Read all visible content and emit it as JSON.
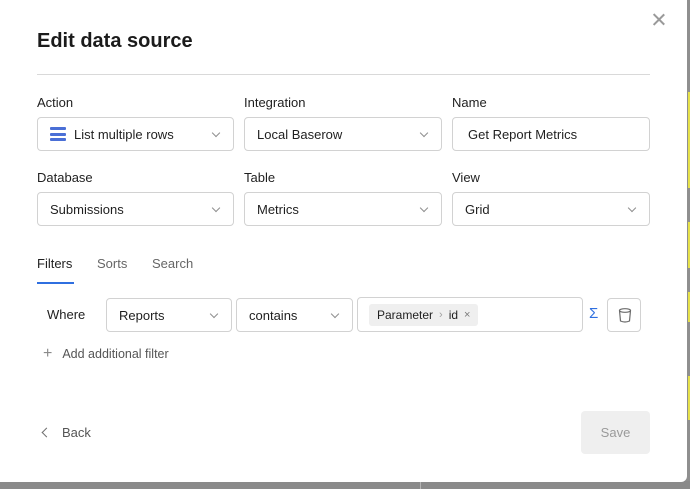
{
  "modal": {
    "title": "Edit data source",
    "fields": {
      "action": {
        "label": "Action",
        "value": "List multiple rows",
        "icon": "list-rows-icon"
      },
      "integration": {
        "label": "Integration",
        "value": "Local Baserow"
      },
      "name": {
        "label": "Name",
        "value": "Get Report Metrics"
      },
      "database": {
        "label": "Database",
        "value": "Submissions"
      },
      "table": {
        "label": "Table",
        "value": "Metrics"
      },
      "view": {
        "label": "View",
        "value": "Grid"
      }
    },
    "tabs": [
      {
        "label": "Filters",
        "active": true
      },
      {
        "label": "Sorts",
        "active": false
      },
      {
        "label": "Search",
        "active": false
      }
    ],
    "filter": {
      "where_label": "Where",
      "field": "Reports",
      "operator": "contains",
      "value_chip": {
        "part1": "Parameter",
        "separator": "›",
        "part2": "id",
        "remove": "×"
      },
      "formula_icon": "Σ"
    },
    "add_filter_label": "Add additional filter",
    "footer": {
      "back_label": "Back",
      "save_label": "Save"
    },
    "colors": {
      "accent": "#2f6fe0",
      "list_icon": "#4a6fd6"
    }
  }
}
